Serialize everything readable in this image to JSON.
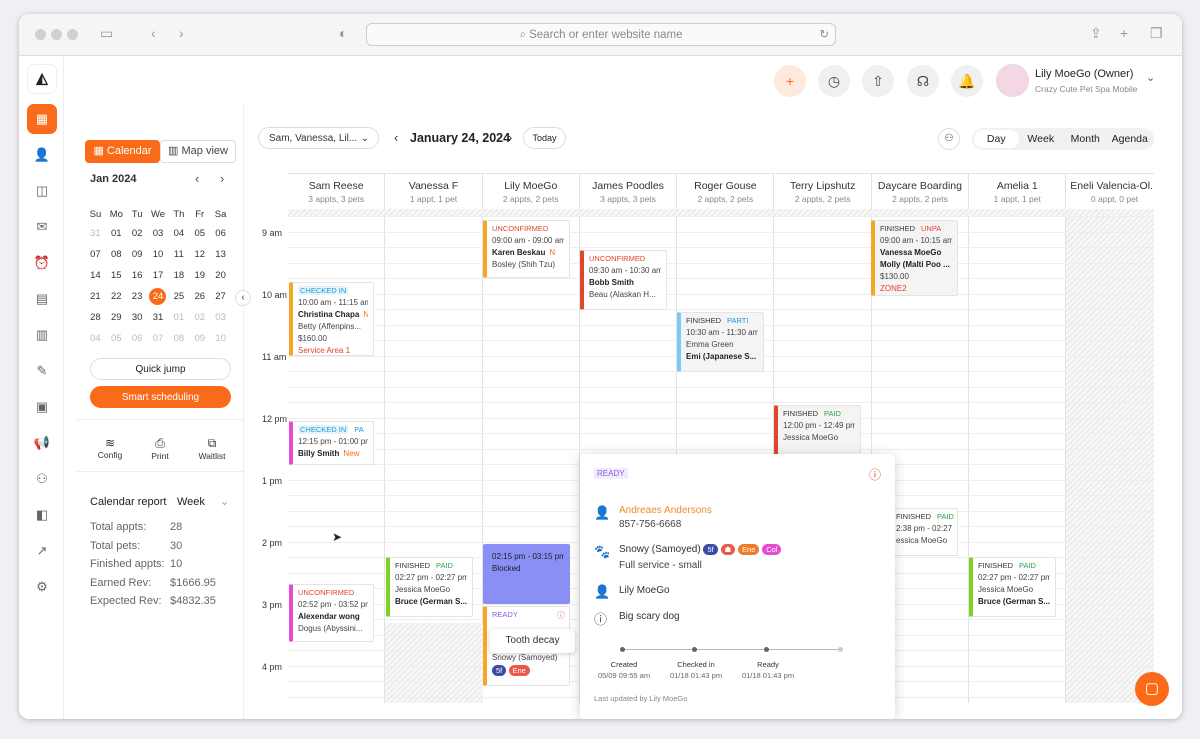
{
  "browser": {
    "url_placeholder": "Search or enter website name"
  },
  "user": {
    "name": "Lily MoeGo (Owner)",
    "business": "Crazy Cute Pet Spa Mobile"
  },
  "left": {
    "view_calendar": "Calendar",
    "view_map": "Map view",
    "month_title": "Jan 2024",
    "weekdays": [
      "Su",
      "Mo",
      "Tu",
      "We",
      "Th",
      "Fr",
      "Sa"
    ],
    "weeks": [
      [
        "31",
        "01",
        "02",
        "03",
        "04",
        "05",
        "06"
      ],
      [
        "07",
        "08",
        "09",
        "10",
        "11",
        "12",
        "13"
      ],
      [
        "14",
        "15",
        "16",
        "17",
        "18",
        "19",
        "20"
      ],
      [
        "21",
        "22",
        "23",
        "24",
        "25",
        "26",
        "27"
      ],
      [
        "28",
        "29",
        "30",
        "31",
        "01",
        "02",
        "03"
      ],
      [
        "04",
        "05",
        "06",
        "07",
        "08",
        "09",
        "10"
      ]
    ],
    "quick_jump": "Quick jump",
    "smart_scheduling": "Smart scheduling",
    "tools": [
      "Config",
      "Print",
      "Waitlist"
    ],
    "report_title": "Calendar report",
    "report_period": "Week",
    "report": [
      {
        "label": "Total appts:",
        "value": "28"
      },
      {
        "label": "Total pets:",
        "value": "30"
      },
      {
        "label": "Finished appts:",
        "value": "10"
      },
      {
        "label": "Earned Rev:",
        "value": "$1666.95"
      },
      {
        "label": "Expected Rev:",
        "value": "$4832.35"
      }
    ]
  },
  "header": {
    "staff_filter": "Sam, Vanessa, Lil...",
    "date": "January 24, 2024",
    "today": "Today",
    "views": [
      "Day",
      "Week",
      "Month",
      "Agenda"
    ],
    "active_view": "Day"
  },
  "columns": [
    {
      "name": "Sam Reese",
      "sub": "3 appts, 3 pets"
    },
    {
      "name": "Vanessa F",
      "sub": "1 appt, 1 pet"
    },
    {
      "name": "Lily MoeGo",
      "sub": "2 appts, 2 pets"
    },
    {
      "name": "James Poodles",
      "sub": "3 appts, 3 pets"
    },
    {
      "name": "Roger Gouse",
      "sub": "2 appts, 2 pets"
    },
    {
      "name": "Terry Lipshutz",
      "sub": "2 appts, 2 pets"
    },
    {
      "name": "Daycare Boarding",
      "sub": "2 appts, 2 pets"
    },
    {
      "name": "Amelia 1",
      "sub": "1 appt, 1 pet"
    },
    {
      "name": "Eneli Valencia-Ol...",
      "sub": "0 appt, 0 pet"
    }
  ],
  "times": [
    "9 am",
    "10 am",
    "11 am",
    "12 pm",
    "1 pm",
    "2 pm",
    "3 pm",
    "4 pm"
  ],
  "cards": [
    {
      "status": "CHECKED IN",
      "status2": "",
      "time": "10:00 am - 11:15 am",
      "client": "Christina Chapa",
      "tag": "N",
      "pet": "Betty (Affenpins...",
      "extra": "$160.00",
      "extra2": "Service Area 1"
    },
    {
      "status": "CHECKED IN",
      "status2": "PA",
      "time": "12:15 pm - 01:00 pm",
      "client": "Billy Smith",
      "tag": "New",
      "pet": "",
      "extra": "",
      "extra2": ""
    },
    {
      "status": "UNCONFIRMED",
      "status2": "",
      "time": "02:52 pm - 03:52 pm",
      "client": "Alexendar wong",
      "tag": "",
      "pet": "Dogus (Abyssini...",
      "extra": "",
      "extra2": ""
    },
    {
      "status": "FINISHED",
      "status2": "PAID",
      "time": "02:27 pm - 02:27 pm",
      "client": "Jessica MoeGo",
      "tag": "",
      "pet": "Bruce (German S...",
      "extra": "",
      "extra2": ""
    },
    {
      "status": "UNCONFIRMED",
      "status2": "",
      "time": "09:00 am - 09:00 am",
      "client": "Karen Beskau",
      "tag": "N",
      "pet": "Bosley (Shih Tzu)",
      "extra": "",
      "extra2": ""
    },
    {
      "status": "UNCONFIRMED",
      "status2": "",
      "time": "09:30 am - 10:30 am",
      "client": "Bobb Smith",
      "tag": "",
      "pet": "Beau (Alaskan H...",
      "extra": "",
      "extra2": ""
    },
    {
      "status": "FINISHED",
      "status2": "PARTI",
      "time": "10:30 am - 11:30 am",
      "client": "Emma Green",
      "tag": "",
      "pet": "Emi (Japanese S...",
      "extra": "",
      "extra2": ""
    },
    {
      "status": "FINISHED",
      "status2": "PAID",
      "time": "12:00 pm - 12:49 pm",
      "client": "Jessica MoeGo",
      "tag": "",
      "pet": "",
      "extra": "",
      "extra2": ""
    },
    {
      "status": "FINISHED",
      "status2": "UNPA",
      "time": "09:00 am - 10:15 am",
      "client": "Vanessa MoeGo",
      "tag": "",
      "pet": "Molly (Malti Poo ...",
      "extra": "$130.00",
      "extra2": "ZONE2"
    },
    {
      "status": "FINISHED",
      "status2": "PAID",
      "time": "2:38 pm - 02:27 pm",
      "client": "essica MoeGo",
      "tag": "",
      "pet": "",
      "extra": "",
      "extra2": ""
    },
    {
      "status": "FINISHED",
      "status2": "PAID",
      "time": "02:27 pm - 02:27 pm",
      "client": "Jessica MoeGo",
      "tag": "",
      "pet": "Bruce (German S...",
      "extra": "",
      "extra2": ""
    }
  ],
  "blocked": {
    "time": "02:15 pm - 03:15 pm",
    "label": "Blocked"
  },
  "ready_card": {
    "status": "READY",
    "pet": "Snowy (Samoyed)",
    "tooltip": "Tooth decay",
    "pills": [
      "5f",
      "Ene"
    ]
  },
  "popover": {
    "status": "READY",
    "client": "Andreaes Andersons",
    "phone": "857-756-6668",
    "pet": "Snowy (Samoyed)",
    "pet_tags": [
      "5f",
      "Ene",
      "Col"
    ],
    "service": "Full service - small",
    "staff": "Lily MoeGo",
    "note": "Big scary dog",
    "timeline": [
      {
        "label": "Created",
        "time": "05/09 09:55 am"
      },
      {
        "label": "Checked in",
        "time": "01/18 01:43 pm"
      },
      {
        "label": "Ready",
        "time": "01/18 01:43 pm"
      }
    ],
    "footer": "Last updated by Lily MoeGo"
  },
  "colors": {
    "accent": "#f96b18",
    "unconfirmed": "#e0452e",
    "checked_in": "#1a9ad6",
    "finished": "#2aa34a",
    "blocked": "#8a8ff5"
  }
}
